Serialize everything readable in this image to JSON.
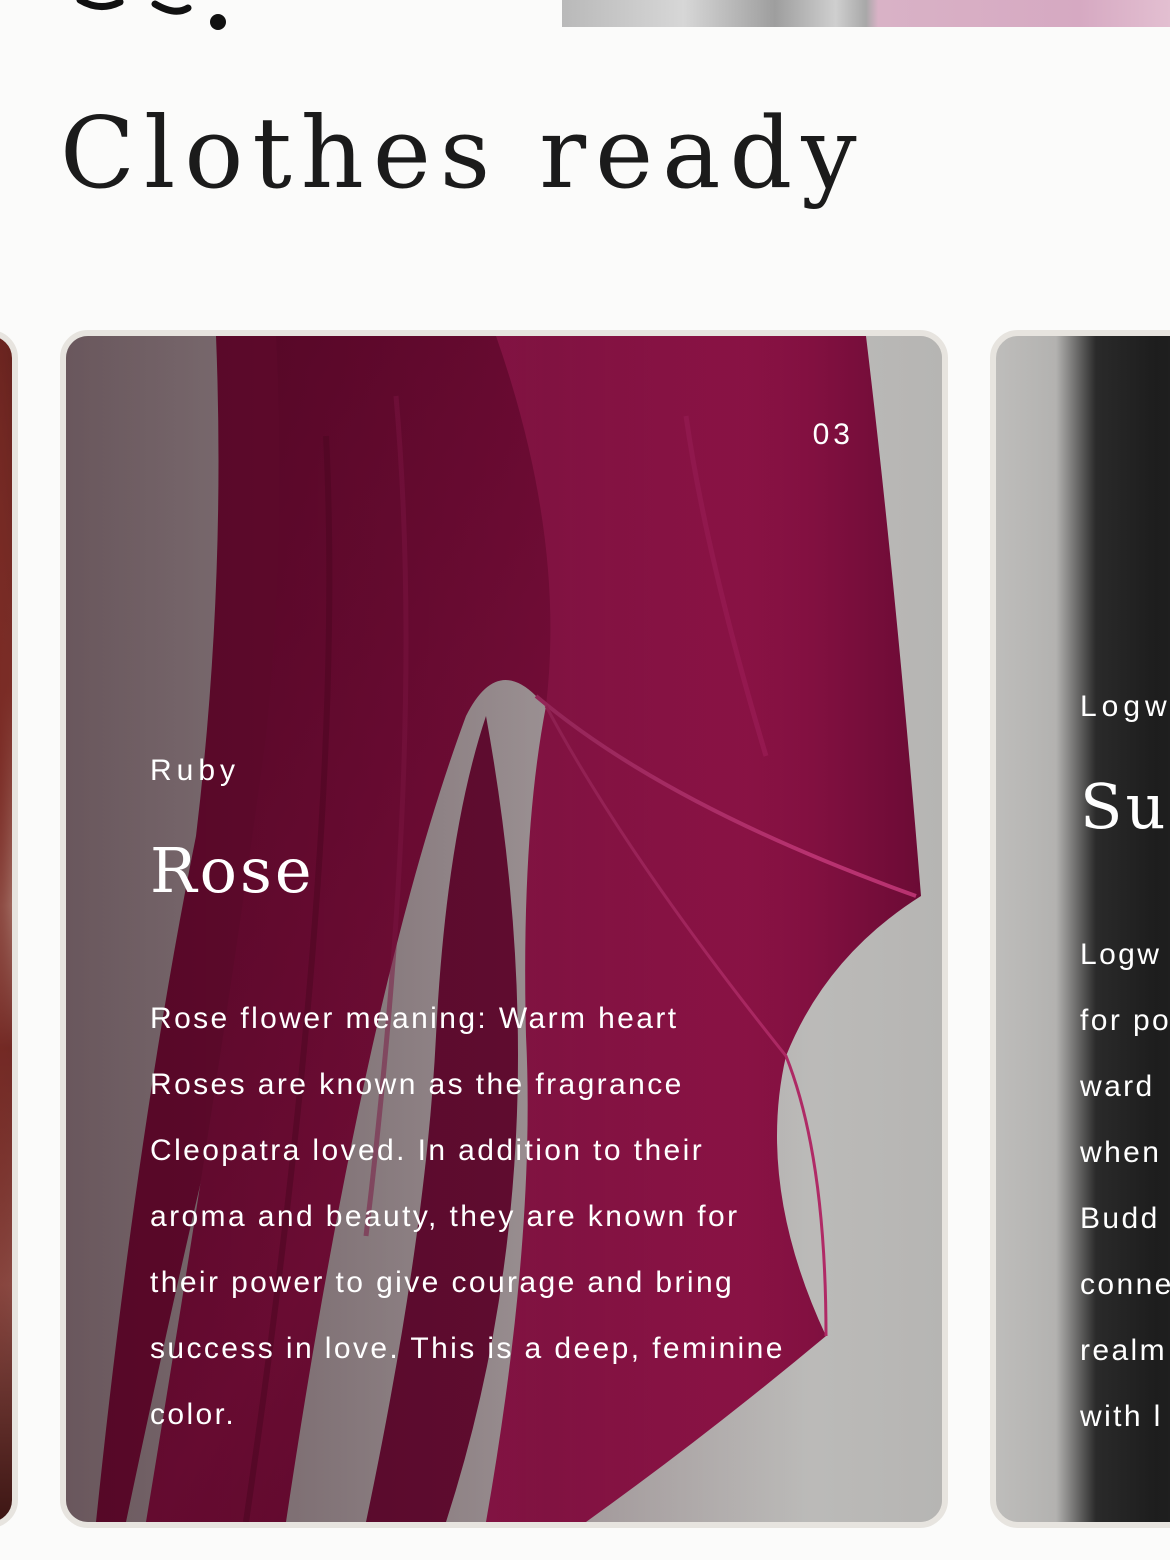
{
  "header": {
    "title": "Clothes ready"
  },
  "cards": {
    "main": {
      "number": "03",
      "subtitle": "Ruby",
      "title": "Rose",
      "description_lines": [
        "Rose flower meaning: Warm heart",
        "Roses are known as the fragrance",
        "Cleopatra loved. In addition to their",
        "aroma and beauty, they are known for",
        "their power to give courage and bring",
        "success in love. This is a deep, feminine",
        "color."
      ],
      "color": "#8e1246"
    },
    "next": {
      "subtitle": "Logw",
      "title": "Sur",
      "description_lines": [
        "Logw",
        "for po",
        "ward",
        "when",
        "Budd",
        "conne",
        "realm",
        "with l"
      ],
      "color": "#1f1f1f"
    }
  },
  "colors": {
    "background": "#fbfbfa",
    "card_border": "#e7e4df",
    "text_on_card": "#ffffff",
    "title_text": "#1b1b1b"
  }
}
